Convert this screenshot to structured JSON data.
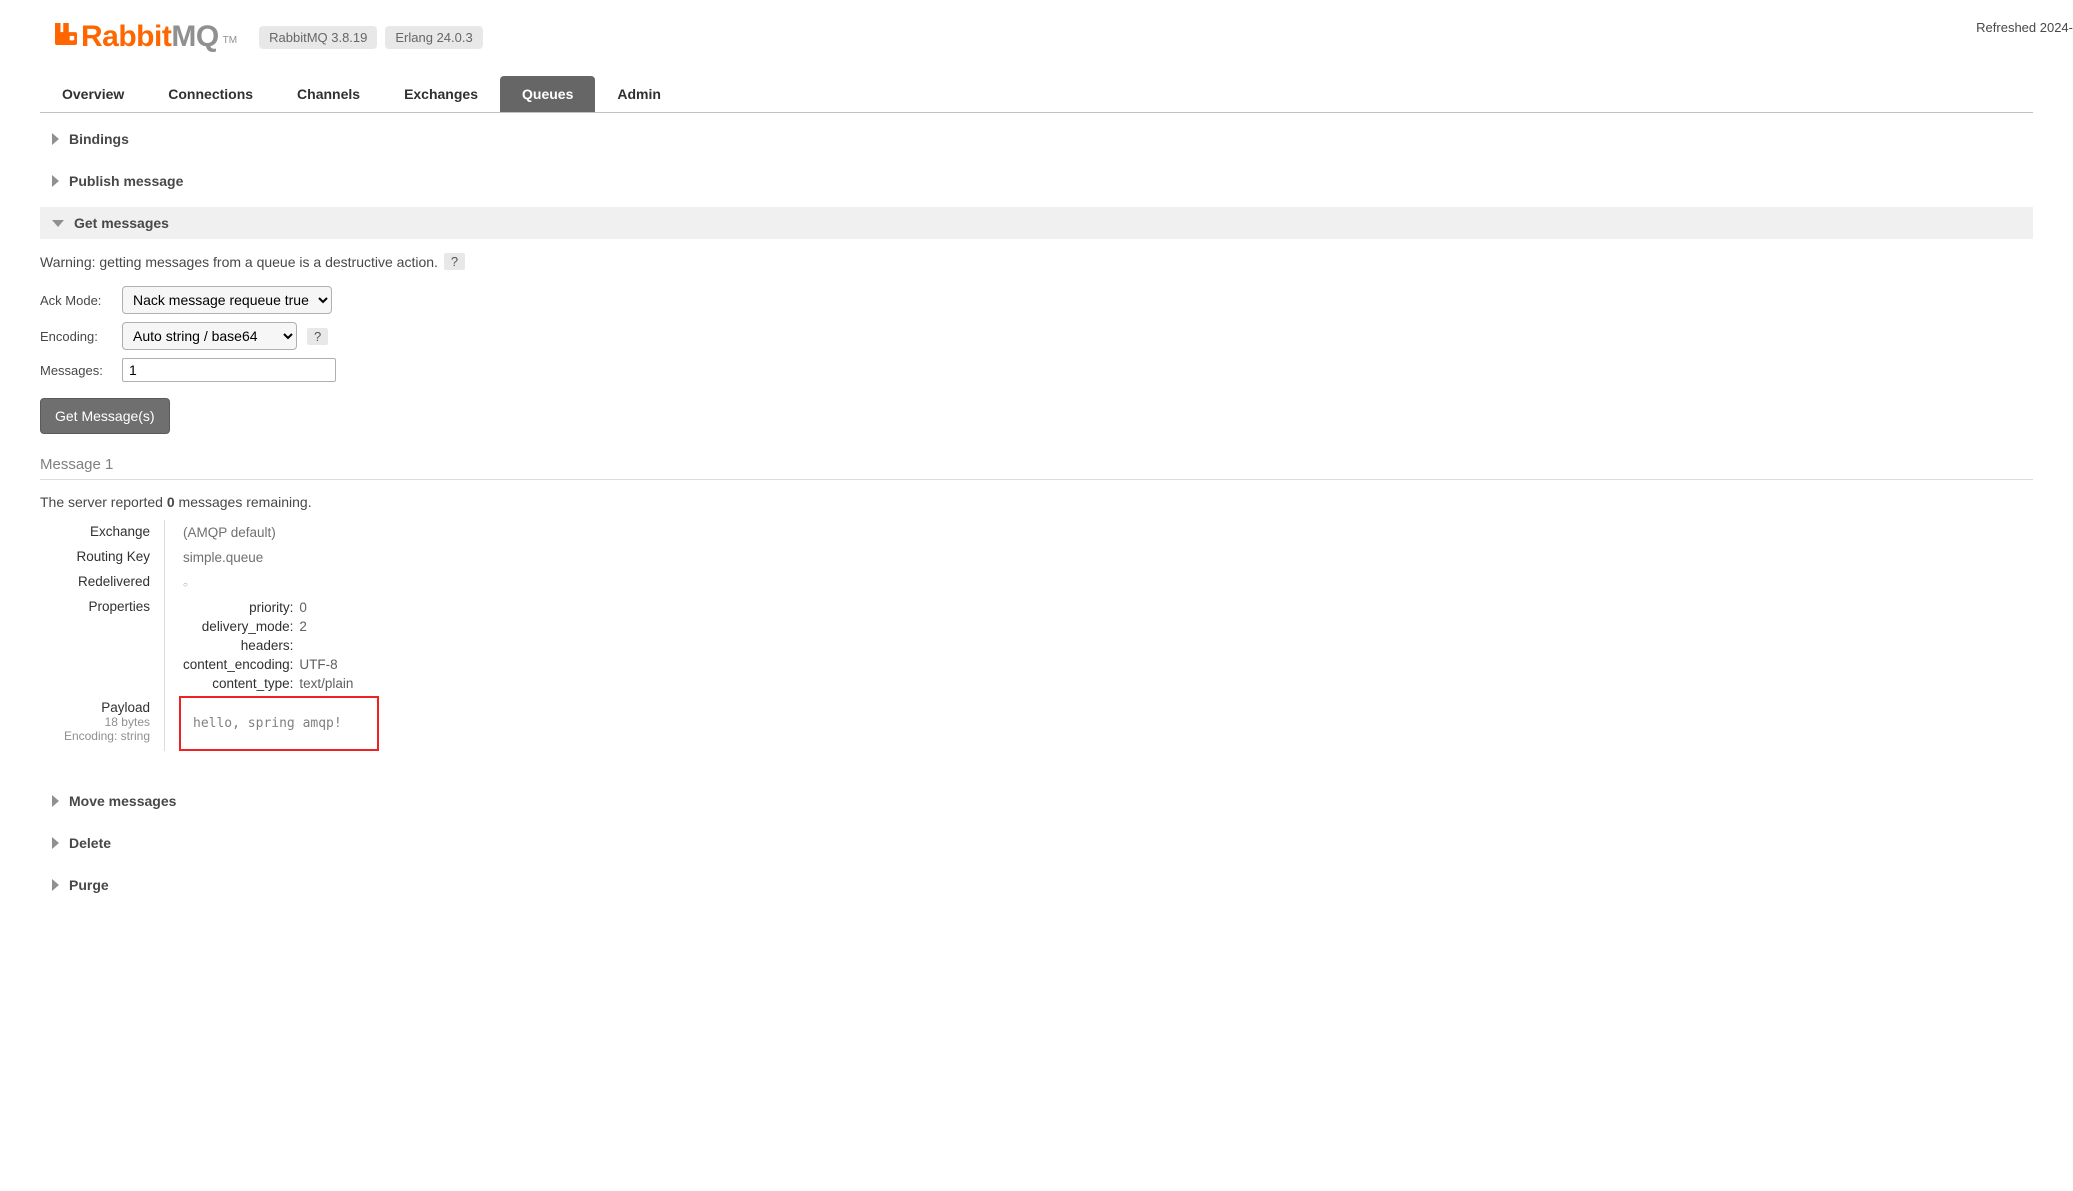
{
  "header": {
    "logo_first": "Rabbit",
    "logo_second": "MQ",
    "logo_tm": "TM",
    "version_app": "RabbitMQ 3.8.19",
    "version_erlang": "Erlang 24.0.3",
    "refreshed": "Refreshed 2024-"
  },
  "tabs": {
    "overview": "Overview",
    "connections": "Connections",
    "channels": "Channels",
    "exchanges": "Exchanges",
    "queues": "Queues",
    "admin": "Admin"
  },
  "sections": {
    "bindings": "Bindings",
    "publish": "Publish message",
    "get": "Get messages",
    "move": "Move messages",
    "delete": "Delete",
    "purge": "Purge"
  },
  "get_messages": {
    "warning": "Warning: getting messages from a queue is a destructive action.",
    "help": "?",
    "ack_mode_label": "Ack Mode:",
    "ack_mode_value": "Nack message requeue true",
    "encoding_label": "Encoding:",
    "encoding_value": "Auto string / base64",
    "messages_label": "Messages:",
    "messages_value": "1",
    "button": "Get Message(s)"
  },
  "message": {
    "title": "Message 1",
    "remaining_pre": "The server reported ",
    "remaining_count": "0",
    "remaining_post": " messages remaining.",
    "exchange_label": "Exchange",
    "exchange_value": "(AMQP default)",
    "routing_key_label": "Routing Key",
    "routing_key_value": "simple.queue",
    "redelivered_label": "Redelivered",
    "redelivered_value": "○",
    "properties_label": "Properties",
    "props": {
      "priority_k": "priority:",
      "priority_v": "0",
      "delivery_mode_k": "delivery_mode:",
      "delivery_mode_v": "2",
      "headers_k": "headers:",
      "headers_v": "",
      "content_encoding_k": "content_encoding:",
      "content_encoding_v": "UTF-8",
      "content_type_k": "content_type:",
      "content_type_v": "text/plain"
    },
    "payload_label": "Payload",
    "payload_size": "18 bytes",
    "payload_encoding": "Encoding: string",
    "payload_value": "hello, spring amqp!"
  }
}
